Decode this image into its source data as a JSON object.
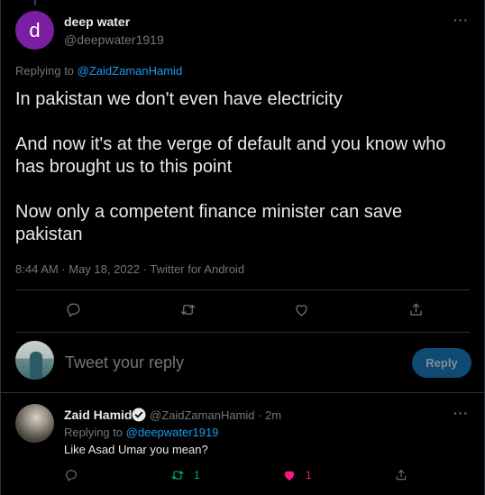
{
  "main_tweet": {
    "avatar_letter": "d",
    "author_name": "deep water",
    "author_handle": "@deepwater1919",
    "more_label": "···",
    "replying_prefix": "Replying to ",
    "replying_to": "@ZaidZamanHamid",
    "text": [
      "In pakistan we don't even have electricity",
      "And now it's at the verge of default and you know who has brought us to this point",
      "Now only a competent finance minister can save pakistan"
    ],
    "meta": "8:44 AM · May 18, 2022 · Twitter for Android",
    "actions": [
      "reply-icon",
      "retweet-icon",
      "like-icon",
      "share-icon"
    ]
  },
  "composer": {
    "placeholder": "Tweet your reply",
    "button_label": "Reply"
  },
  "reply_tweet": {
    "author_name": "Zaid Hamid",
    "author_handle": "@ZaidZamanHamid · 2m",
    "more_label": "···",
    "replying_prefix": "Replying to ",
    "replying_to": "@deepwater1919",
    "text": "Like Asad Umar you mean?",
    "retweet_count": "1",
    "like_count": "1",
    "colors": {
      "retweet_active": "#00ba7c",
      "like_active": "#f91880"
    }
  },
  "colors": {
    "background": "#000000",
    "accent": "#1d9bf0",
    "muted": "#71767b",
    "avatar_d": "#7b1fa2",
    "reply_button_bg": "#0e4a72"
  }
}
